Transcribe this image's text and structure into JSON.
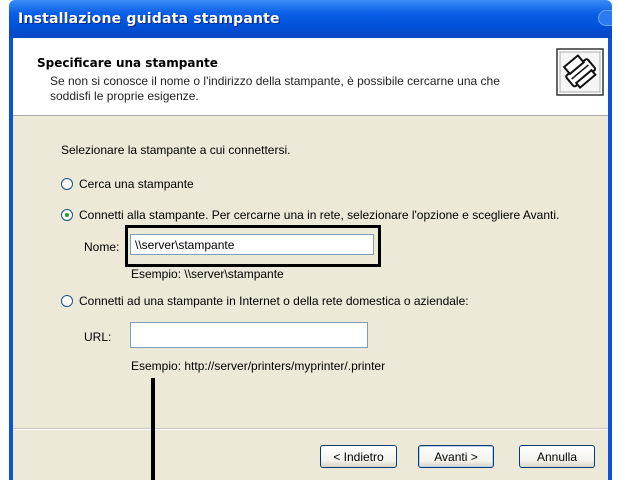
{
  "window": {
    "title": "Installazione guidata stampante"
  },
  "header": {
    "title": "Specificare una stampante",
    "description": "Se non si conosce il nome o l'indirizzo della stampante, è possibile cercarne una che soddisfi le proprie esigenze.",
    "icon": "printer-wizard-icon"
  },
  "main": {
    "prompt": "Selezionare la stampante a cui connettersi.",
    "options": [
      {
        "label": "Cerca una stampante",
        "selected": false
      },
      {
        "label": "Connetti alla stampante. Per cercarne una in rete, selezionare l'opzione e scegliere Avanti.",
        "selected": true
      },
      {
        "label": "Connetti ad una stampante in Internet o della rete domestica o aziendale:",
        "selected": false
      }
    ],
    "name_field": {
      "label": "Nome:",
      "value": "\\\\server\\stampante",
      "example": "Esempio: \\\\server\\stampante"
    },
    "url_field": {
      "label": "URL:",
      "value": "",
      "example": "Esempio: http://server/printers/myprinter/.printer"
    }
  },
  "buttons": {
    "back": "< Indietro",
    "next": "Avanti >",
    "cancel": "Annulla"
  },
  "colors": {
    "titlebar": "#0150d8",
    "dialog_bg": "#ece9d8",
    "radio_selected": "#21a121",
    "annotation": "#000000"
  }
}
